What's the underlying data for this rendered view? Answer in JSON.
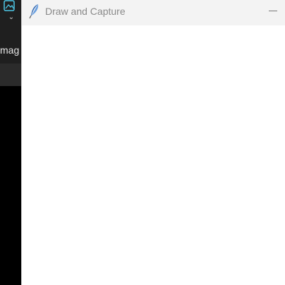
{
  "background_app": {
    "partial_label": "mag",
    "chevron": "⌄",
    "icon": "image-app-icon"
  },
  "window": {
    "title": "Draw and Capture",
    "icon": "feather-icon",
    "minimize_glyph": "—"
  },
  "colors": {
    "titlebar_bg": "#f3f3f3",
    "title_text": "#8a8a8a",
    "canvas_bg": "#ffffff",
    "background_app_bg": "#000000",
    "icon_accent": "#4ec9e8"
  }
}
